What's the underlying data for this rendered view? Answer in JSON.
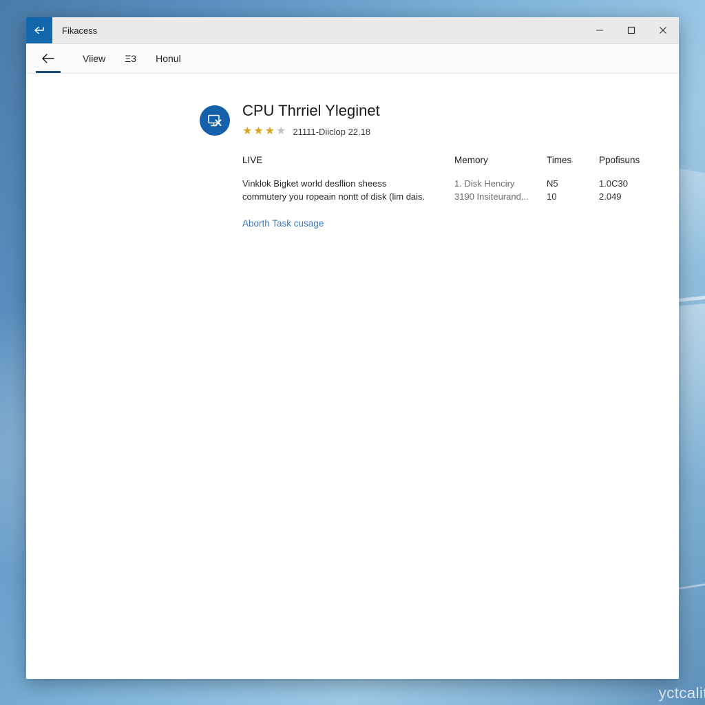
{
  "desktop": {
    "watermark": "yctcalit",
    "background_color": "#6aa0cc"
  },
  "window": {
    "title": "Fikacess",
    "icon": "back-arrow-icon",
    "controls": {
      "minimize": "—",
      "maximize": "☐",
      "close": "✕"
    }
  },
  "nav": {
    "back": "←",
    "items": [
      {
        "label": "Viiew",
        "name": "nav-item-view"
      },
      {
        "label": "Ξ3",
        "name": "nav-item-list"
      },
      {
        "label": "Honul",
        "name": "nav-item-honul"
      }
    ]
  },
  "app": {
    "icon": "monitor-x-icon",
    "title": "CPU Thrriel Yleginet",
    "rating": {
      "filled": 3,
      "empty": 1,
      "stars": [
        "★",
        "★",
        "★",
        "★"
      ],
      "text": "21111-Diiclop 22.18",
      "star_color": "#d9a520",
      "star_empty_color": "#c3c3c3"
    }
  },
  "details": {
    "description": {
      "heading": "LIVE",
      "lines": [
        "Vinklok Bigket world desflion sheess",
        "commutery you ropeain nontt of disk (lim dais."
      ],
      "action_link": "Aborth Task cusage"
    },
    "columns": [
      {
        "name": "memory",
        "header": "Memory",
        "values": [
          "1. Disk Henciry",
          "3190 Insiteurand..."
        ]
      },
      {
        "name": "times",
        "header": "Times",
        "values": [
          "N5",
          "10"
        ]
      },
      {
        "name": "properties",
        "header": "Ppofisuns",
        "values": [
          "1.0C30",
          "2.049"
        ]
      }
    ]
  }
}
